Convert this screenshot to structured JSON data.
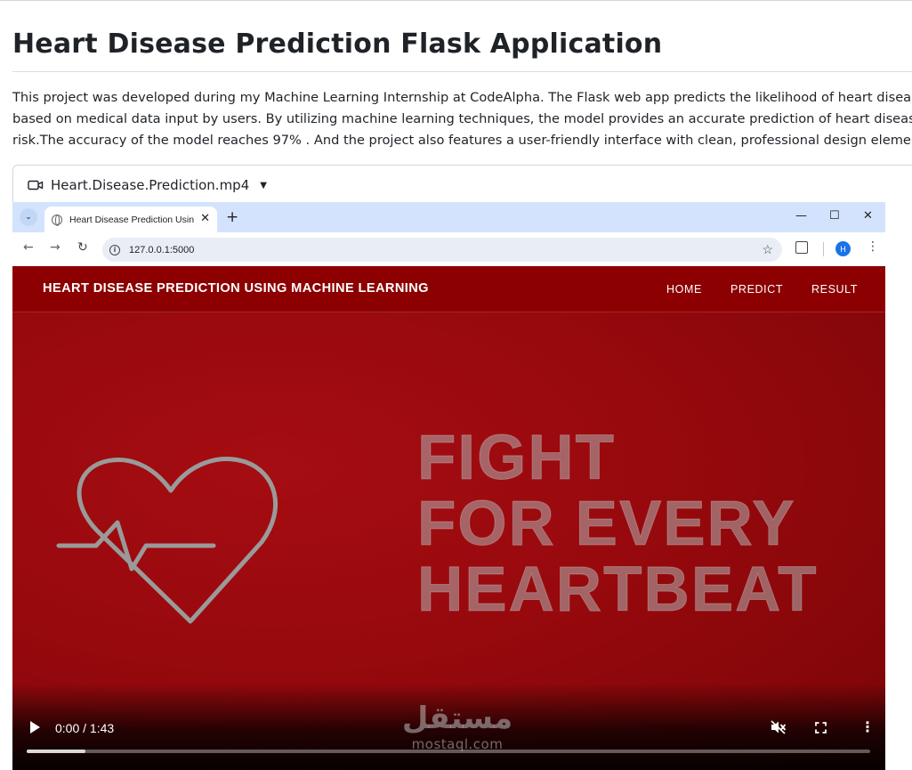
{
  "page": {
    "title": "Heart Disease Prediction Flask Application",
    "description_lines": [
      "This project was developed during my Machine Learning Internship at CodeAlpha. The Flask web app predicts the likelihood of heart disease",
      "based on medical data input by users. By utilizing machine learning techniques, the model provides an accurate prediction of heart disease",
      "risk.The accuracy of the model reaches 97% . And the project also features a user-friendly interface with clean, professional design elements."
    ]
  },
  "video": {
    "file_name": "Heart.Disease.Prediction.mp4",
    "icon": "video-camera-icon",
    "time": "0:00 / 1:43",
    "progress_fraction": 0.07
  },
  "browser": {
    "tab_title": "Heart Disease Prediction Using",
    "url": "127.0.0.1:5000",
    "profile_initial": "H",
    "accent": "#d3e3fd"
  },
  "site": {
    "brand": "HEART DISEASE PREDICTION USING MACHINE LEARNING",
    "nav": [
      "HOME",
      "PREDICT",
      "RESULT"
    ],
    "hero_lines": [
      "FIGHT",
      "FOR EVERY",
      "HEARTBEAT"
    ],
    "background_color": "#97090d"
  },
  "watermark": {
    "arabic": "مستقل",
    "latin": "mostaql.com"
  }
}
